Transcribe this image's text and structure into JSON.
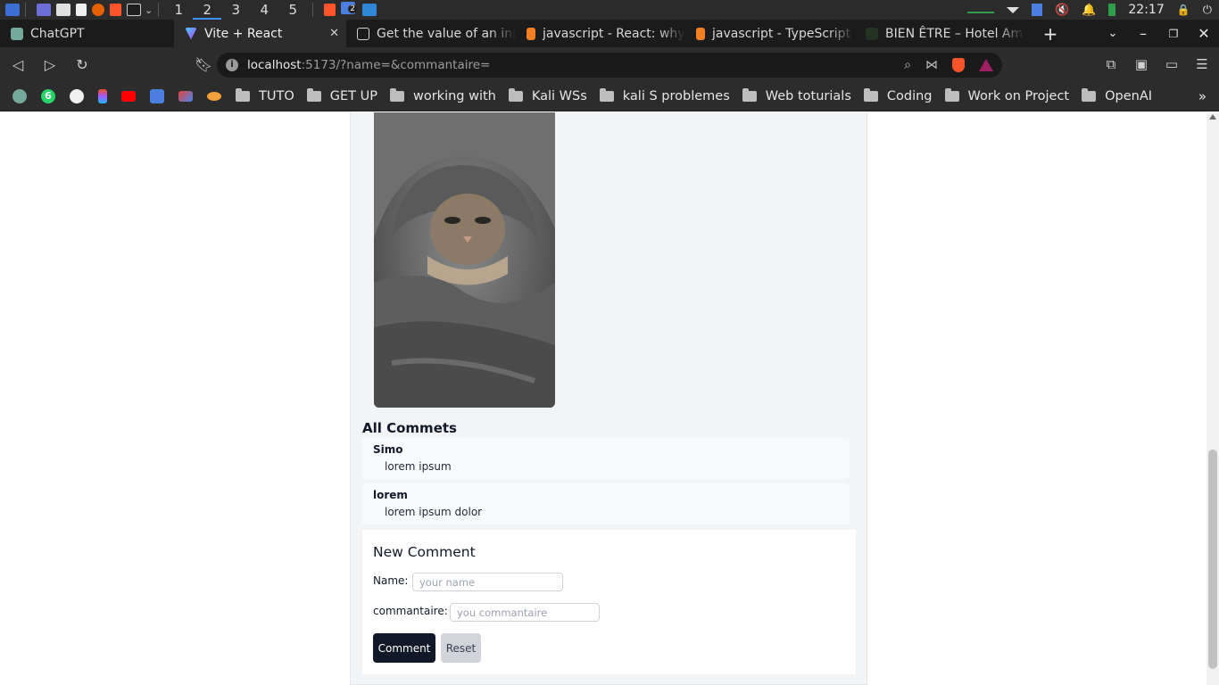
{
  "taskbar": {
    "workspaces": [
      "1",
      "2",
      "3",
      "4",
      "5"
    ],
    "active_workspace": "2",
    "brave_badge": "2",
    "clock": "22:17"
  },
  "tabs": [
    {
      "title": "ChatGPT",
      "icon": "chatgpt-icon",
      "active": false
    },
    {
      "title": "Vite + React",
      "icon": "vite-icon",
      "active": true
    },
    {
      "title": "Get the value of an inpu",
      "icon": "codesandbox-icon",
      "active": false
    },
    {
      "title": "javascript - React: why c",
      "icon": "stackoverflow-icon",
      "active": false
    },
    {
      "title": "javascript - TypeScript i",
      "icon": "stackoverflow-icon",
      "active": false
    },
    {
      "title": "BIEN ÊTRE – Hotel Ama",
      "icon": "hotel-icon",
      "active": false
    }
  ],
  "address_bar": {
    "host": "localhost",
    "path": ":5173/?name=&commantaire="
  },
  "bookmarks": {
    "icons": [
      "chatgpt-icon",
      "whatsapp-icon",
      "github-icon",
      "figma-icon",
      "youtube-icon",
      "translate-icon",
      "gmail-icon",
      "bookmark-app-icon"
    ],
    "whatsapp_badge": "6",
    "folders": [
      "TUTO",
      "GET UP",
      "working with",
      "Kali WSs",
      "kali S problemes",
      "Web toturials",
      "Coding",
      "Work on Project",
      "OpenAI"
    ]
  },
  "page": {
    "comments_title": "All Commets",
    "comments": [
      {
        "author": "Simo",
        "text": "lorem ipsum"
      },
      {
        "author": "lorem",
        "text": "lorem ipsum dolor"
      }
    ],
    "form": {
      "title": "New Comment",
      "name_label": "Name:",
      "name_value": "",
      "name_placeholder": "your name",
      "commentaire_label": "commantaire:",
      "commentaire_value": "",
      "commentaire_placeholder": "you commantaire",
      "submit_label": "Comment",
      "reset_label": "Reset"
    }
  },
  "colors": {
    "accent_button": "#111827",
    "secondary_button": "#d1d5db",
    "browser_dark": "#2c2c2c",
    "brave_orange": "#fb542b"
  }
}
